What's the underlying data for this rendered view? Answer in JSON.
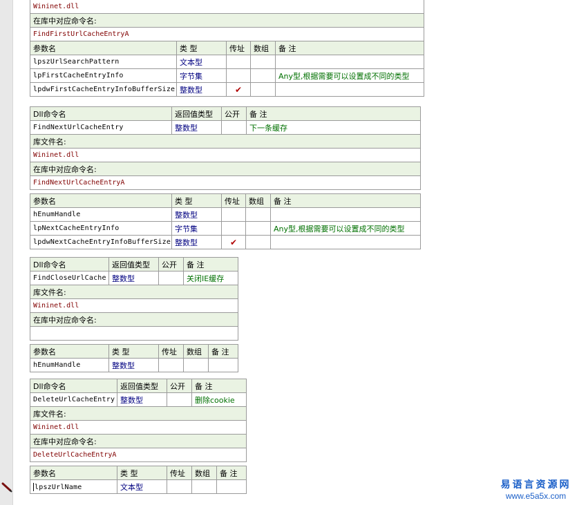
{
  "labels": {
    "dll_cmd": "Dll命令名",
    "ret_type": "返回值类型",
    "public": "公开",
    "remark": "备 注",
    "lib_file": "库文件名:",
    "lib_cmd": "在库中对应命令名:",
    "param_name": "参数名",
    "type": "类 型",
    "byref": "传址",
    "array": "数组"
  },
  "block1": {
    "lib": "Wininet.dll",
    "cmd": "FindFirstUrlCacheEntryA",
    "params": [
      {
        "name": "lpszUrlSearchPattern",
        "type": "文本型",
        "byref": "",
        "array": "",
        "remark": ""
      },
      {
        "name": "lpFirstCacheEntryInfo",
        "type": "字节集",
        "byref": "",
        "array": "",
        "remark": "Any型,根据需要可以设置成不同的类型"
      },
      {
        "name": "lpdwFirstCacheEntryInfoBufferSize",
        "type": "整数型",
        "byref": "✔",
        "array": "",
        "remark": ""
      }
    ]
  },
  "block2": {
    "name": "FindNextUrlCacheEntry",
    "ret": "整数型",
    "public": "",
    "remark": "下一条缓存",
    "lib": "Wininet.dll",
    "cmd": "FindNextUrlCacheEntryA",
    "params": [
      {
        "name": "hEnumHandle",
        "type": "整数型",
        "byref": "",
        "array": "",
        "remark": ""
      },
      {
        "name": "lpNextCacheEntryInfo",
        "type": "字节集",
        "byref": "",
        "array": "",
        "remark": "Any型,根据需要可以设置成不同的类型"
      },
      {
        "name": "lpdwNextCacheEntryInfoBufferSize",
        "type": "整数型",
        "byref": "✔",
        "array": "",
        "remark": ""
      }
    ]
  },
  "block3": {
    "name": "FindCloseUrlCache",
    "ret": "整数型",
    "public": "",
    "remark": "关闭IE缓存",
    "lib": "Wininet.dll",
    "cmd": "",
    "params": [
      {
        "name": "hEnumHandle",
        "type": "整数型",
        "byref": "",
        "array": "",
        "remark": ""
      }
    ]
  },
  "block4": {
    "name": "DeleteUrlCacheEntry",
    "ret": "整数型",
    "public": "",
    "remark": "删除cookie",
    "lib": "Wininet.dll",
    "cmd": "DeleteUrlCacheEntryA",
    "params": [
      {
        "name": "lpszUrlName",
        "type": "文本型",
        "byref": "",
        "array": "",
        "remark": ""
      }
    ]
  },
  "watermark": {
    "line1": "易语言资源网",
    "line2": "www.e5a5x.com"
  },
  "icons": {
    "gutter_marker": "pencil-icon",
    "check": "check-icon"
  }
}
